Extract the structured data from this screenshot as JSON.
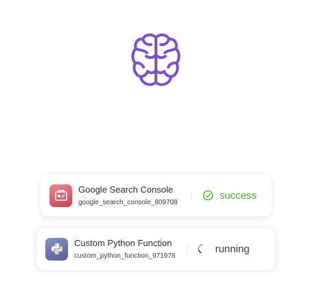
{
  "logo": {
    "icon": "brain-icon",
    "color": "#7b4fd0"
  },
  "steps": [
    {
      "app_name": "Google Search Console",
      "app_id": "google_search_console_809708",
      "icon": "google-search-console-icon",
      "status": "success",
      "status_icon": "check-circle-icon",
      "status_color": "#4caf2f"
    },
    {
      "app_name": "Custom Python Function",
      "app_id": "custom_python_function_971978",
      "icon": "python-icon",
      "status": "running",
      "status_icon": "spinner-icon",
      "status_color": "#3a3a44"
    }
  ]
}
